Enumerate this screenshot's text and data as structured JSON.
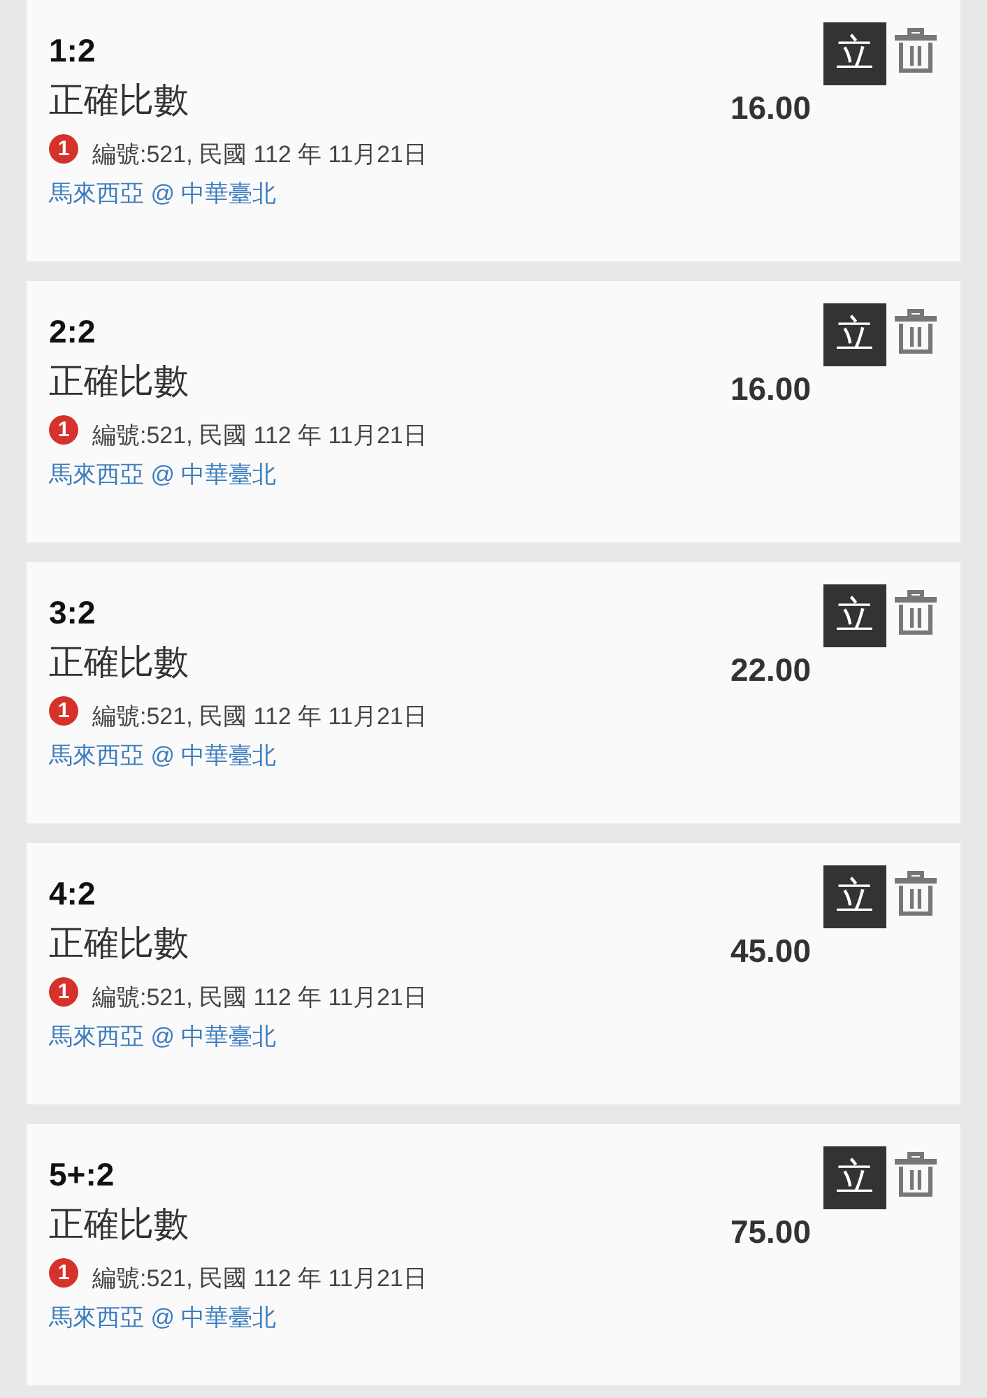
{
  "bets": [
    {
      "score": "1:2",
      "market": "正確比數",
      "badge": "1",
      "info": "編號:521, 民國 112 年 11月21日",
      "match": "馬來西亞 @ 中華臺北",
      "odds": "16.00",
      "button": "立"
    },
    {
      "score": "2:2",
      "market": "正確比數",
      "badge": "1",
      "info": "編號:521, 民國 112 年 11月21日",
      "match": "馬來西亞 @ 中華臺北",
      "odds": "16.00",
      "button": "立"
    },
    {
      "score": "3:2",
      "market": "正確比數",
      "badge": "1",
      "info": "編號:521, 民國 112 年 11月21日",
      "match": "馬來西亞 @ 中華臺北",
      "odds": "22.00",
      "button": "立"
    },
    {
      "score": "4:2",
      "market": "正確比數",
      "badge": "1",
      "info": "編號:521, 民國 112 年 11月21日",
      "match": "馬來西亞 @ 中華臺北",
      "odds": "45.00",
      "button": "立"
    },
    {
      "score": "5+:2",
      "market": "正確比數",
      "badge": "1",
      "info": "編號:521, 民國 112 年 11月21日",
      "match": "馬來西亞 @ 中華臺北",
      "odds": "75.00",
      "button": "立"
    }
  ]
}
